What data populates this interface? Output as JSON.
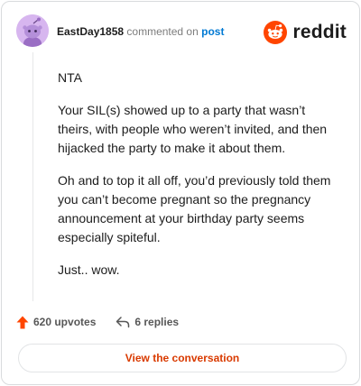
{
  "header": {
    "username": "EastDay1858",
    "action_text": "commented on",
    "post_link": "post",
    "brand": "reddit"
  },
  "comment": {
    "paragraphs": [
      "NTA",
      "Your SIL(s) showed up to a party that wasn’t theirs, with people who weren’t invited, and then hijacked the party to make it about them.",
      "Oh and to top it all off, you’d previously told them you can’t become pregnant so the pregnancy announcement at your birthday party seems especially spiteful.",
      "Just.. wow."
    ]
  },
  "actions": {
    "upvotes": "620 upvotes",
    "replies": "6 replies"
  },
  "footer": {
    "view_label": "View the conversation"
  },
  "colors": {
    "brand": "#ff4500",
    "link": "#0079d3",
    "button_text": "#d93a00",
    "avatar_bg": "#d7b6ef"
  },
  "icons": [
    "avatar-snoo",
    "reddit-logo-icon",
    "upvote-arrow-icon",
    "reply-arrow-icon"
  ]
}
